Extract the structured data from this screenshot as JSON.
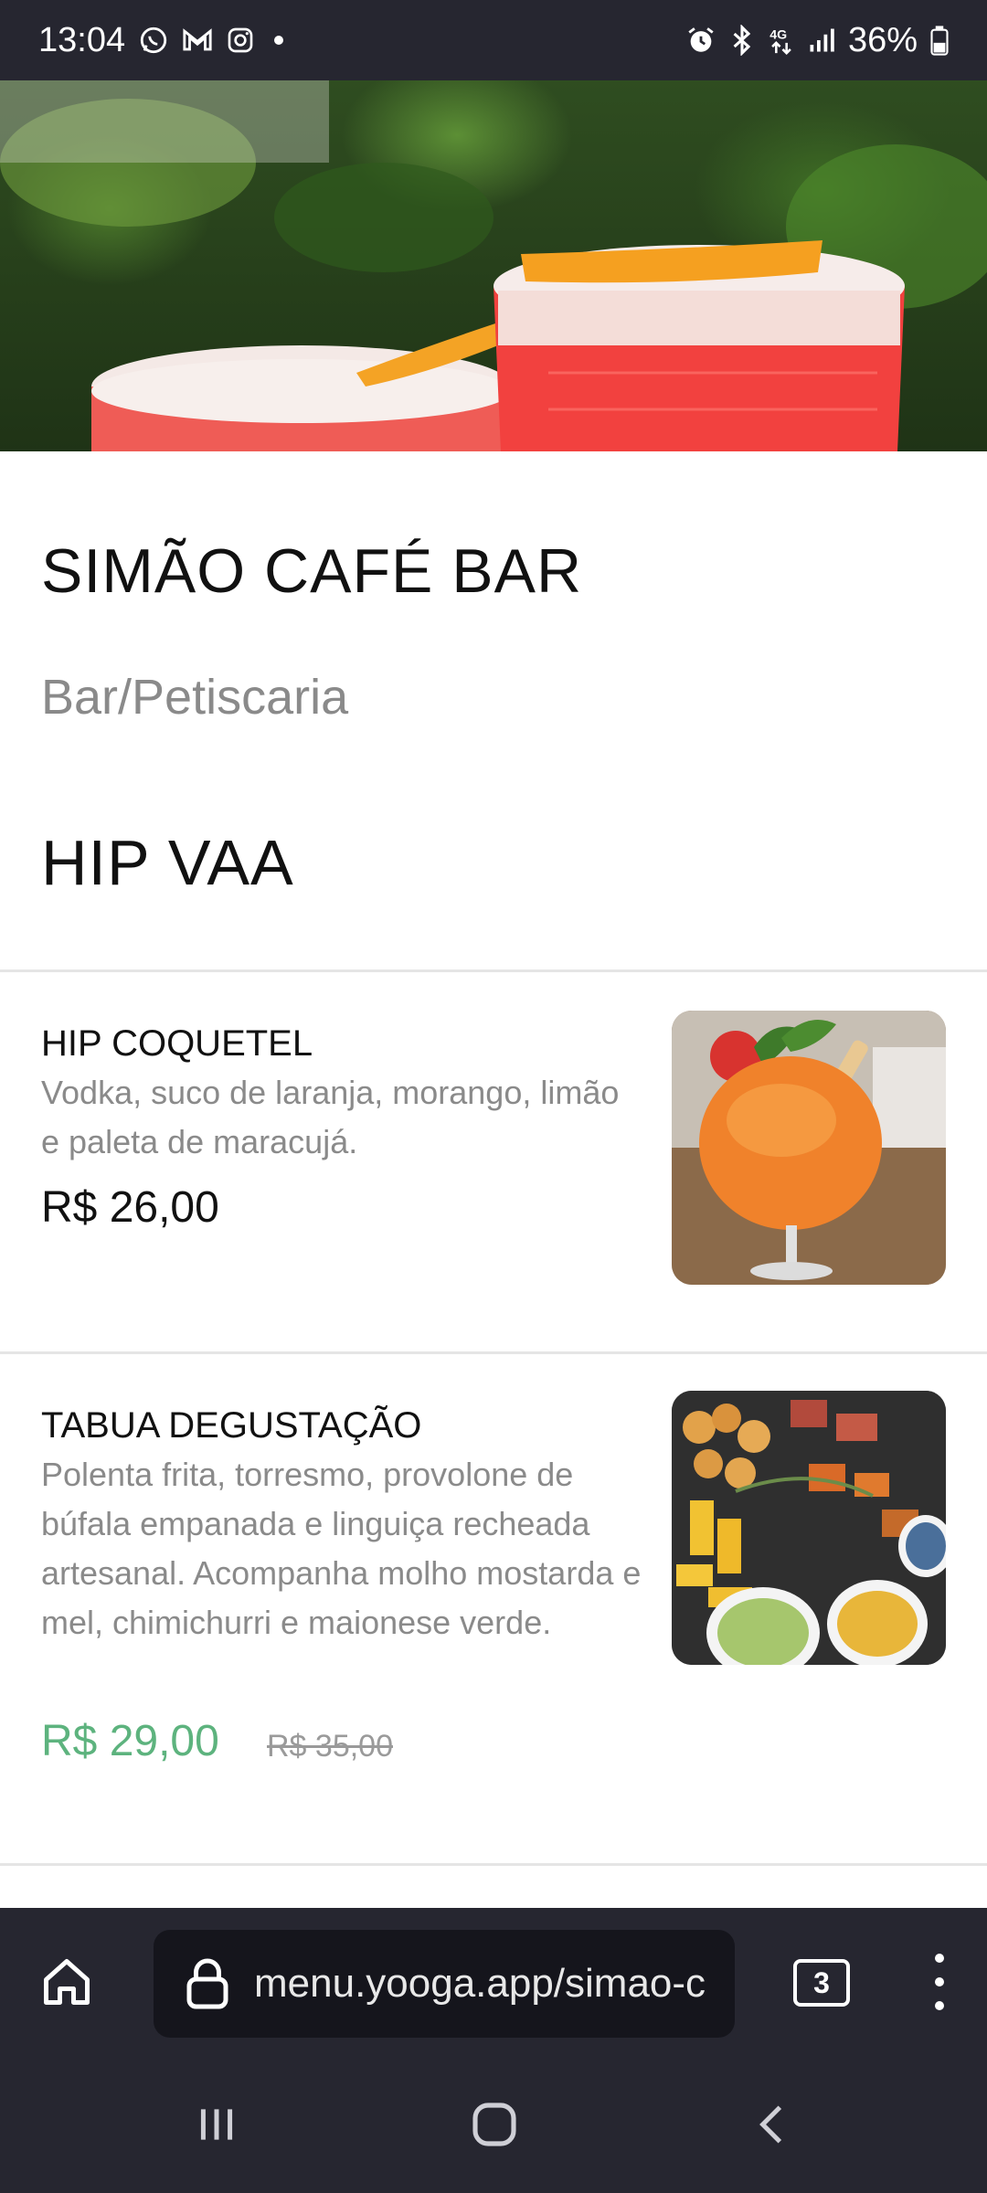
{
  "status": {
    "time": "13:04",
    "battery": "36%",
    "icons": [
      "whatsapp-icon",
      "gmail-icon",
      "instagram-icon",
      "dot-icon",
      "alarm-icon",
      "bluetooth-icon",
      "4g-icon",
      "signal-icon",
      "battery-icon"
    ]
  },
  "restaurant": {
    "name": "SIMÃO CAFÉ BAR",
    "category": "Bar/Petiscaria"
  },
  "section": {
    "title": "HIP VAA"
  },
  "items": [
    {
      "name": "HIP COQUETEL",
      "description": "Vodka, suco de laranja, morango, limão e paleta de maracujá.",
      "price": "R$ 26,00"
    },
    {
      "name": "TABUA DEGUSTAÇÃO",
      "description": "Polenta frita, torresmo, provolone de búfala empanada e linguiça recheada artesanal. Acompanha molho mostarda e mel, chimichurri e maionese verde.",
      "price": "R$ 29,00",
      "old_price": "R$ 35,00"
    }
  ],
  "browser": {
    "url": "menu.yooga.app/simao-c",
    "tab_count": "3"
  },
  "colors": {
    "bar_bg": "#262630",
    "sale_price": "#5db37e",
    "muted_text": "#8a8a8a"
  }
}
